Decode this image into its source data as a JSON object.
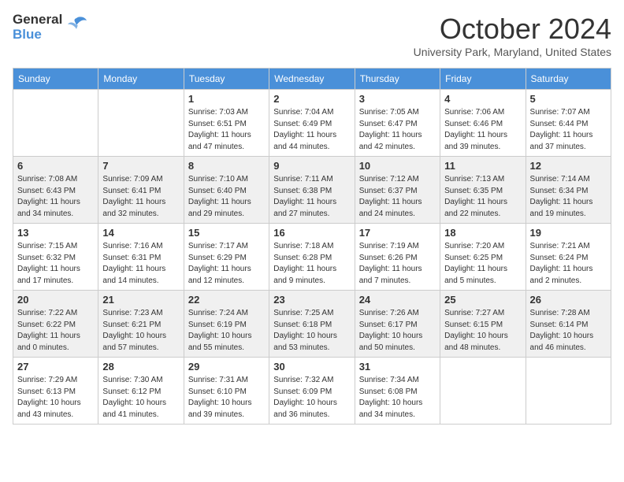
{
  "header": {
    "logo_general": "General",
    "logo_blue": "Blue",
    "month_title": "October 2024",
    "subtitle": "University Park, Maryland, United States"
  },
  "days_of_week": [
    "Sunday",
    "Monday",
    "Tuesday",
    "Wednesday",
    "Thursday",
    "Friday",
    "Saturday"
  ],
  "weeks": [
    [
      {
        "day": "",
        "sunrise": "",
        "sunset": "",
        "daylight": ""
      },
      {
        "day": "",
        "sunrise": "",
        "sunset": "",
        "daylight": ""
      },
      {
        "day": "1",
        "sunrise": "Sunrise: 7:03 AM",
        "sunset": "Sunset: 6:51 PM",
        "daylight": "Daylight: 11 hours and 47 minutes."
      },
      {
        "day": "2",
        "sunrise": "Sunrise: 7:04 AM",
        "sunset": "Sunset: 6:49 PM",
        "daylight": "Daylight: 11 hours and 44 minutes."
      },
      {
        "day": "3",
        "sunrise": "Sunrise: 7:05 AM",
        "sunset": "Sunset: 6:47 PM",
        "daylight": "Daylight: 11 hours and 42 minutes."
      },
      {
        "day": "4",
        "sunrise": "Sunrise: 7:06 AM",
        "sunset": "Sunset: 6:46 PM",
        "daylight": "Daylight: 11 hours and 39 minutes."
      },
      {
        "day": "5",
        "sunrise": "Sunrise: 7:07 AM",
        "sunset": "Sunset: 6:44 PM",
        "daylight": "Daylight: 11 hours and 37 minutes."
      }
    ],
    [
      {
        "day": "6",
        "sunrise": "Sunrise: 7:08 AM",
        "sunset": "Sunset: 6:43 PM",
        "daylight": "Daylight: 11 hours and 34 minutes."
      },
      {
        "day": "7",
        "sunrise": "Sunrise: 7:09 AM",
        "sunset": "Sunset: 6:41 PM",
        "daylight": "Daylight: 11 hours and 32 minutes."
      },
      {
        "day": "8",
        "sunrise": "Sunrise: 7:10 AM",
        "sunset": "Sunset: 6:40 PM",
        "daylight": "Daylight: 11 hours and 29 minutes."
      },
      {
        "day": "9",
        "sunrise": "Sunrise: 7:11 AM",
        "sunset": "Sunset: 6:38 PM",
        "daylight": "Daylight: 11 hours and 27 minutes."
      },
      {
        "day": "10",
        "sunrise": "Sunrise: 7:12 AM",
        "sunset": "Sunset: 6:37 PM",
        "daylight": "Daylight: 11 hours and 24 minutes."
      },
      {
        "day": "11",
        "sunrise": "Sunrise: 7:13 AM",
        "sunset": "Sunset: 6:35 PM",
        "daylight": "Daylight: 11 hours and 22 minutes."
      },
      {
        "day": "12",
        "sunrise": "Sunrise: 7:14 AM",
        "sunset": "Sunset: 6:34 PM",
        "daylight": "Daylight: 11 hours and 19 minutes."
      }
    ],
    [
      {
        "day": "13",
        "sunrise": "Sunrise: 7:15 AM",
        "sunset": "Sunset: 6:32 PM",
        "daylight": "Daylight: 11 hours and 17 minutes."
      },
      {
        "day": "14",
        "sunrise": "Sunrise: 7:16 AM",
        "sunset": "Sunset: 6:31 PM",
        "daylight": "Daylight: 11 hours and 14 minutes."
      },
      {
        "day": "15",
        "sunrise": "Sunrise: 7:17 AM",
        "sunset": "Sunset: 6:29 PM",
        "daylight": "Daylight: 11 hours and 12 minutes."
      },
      {
        "day": "16",
        "sunrise": "Sunrise: 7:18 AM",
        "sunset": "Sunset: 6:28 PM",
        "daylight": "Daylight: 11 hours and 9 minutes."
      },
      {
        "day": "17",
        "sunrise": "Sunrise: 7:19 AM",
        "sunset": "Sunset: 6:26 PM",
        "daylight": "Daylight: 11 hours and 7 minutes."
      },
      {
        "day": "18",
        "sunrise": "Sunrise: 7:20 AM",
        "sunset": "Sunset: 6:25 PM",
        "daylight": "Daylight: 11 hours and 5 minutes."
      },
      {
        "day": "19",
        "sunrise": "Sunrise: 7:21 AM",
        "sunset": "Sunset: 6:24 PM",
        "daylight": "Daylight: 11 hours and 2 minutes."
      }
    ],
    [
      {
        "day": "20",
        "sunrise": "Sunrise: 7:22 AM",
        "sunset": "Sunset: 6:22 PM",
        "daylight": "Daylight: 11 hours and 0 minutes."
      },
      {
        "day": "21",
        "sunrise": "Sunrise: 7:23 AM",
        "sunset": "Sunset: 6:21 PM",
        "daylight": "Daylight: 10 hours and 57 minutes."
      },
      {
        "day": "22",
        "sunrise": "Sunrise: 7:24 AM",
        "sunset": "Sunset: 6:19 PM",
        "daylight": "Daylight: 10 hours and 55 minutes."
      },
      {
        "day": "23",
        "sunrise": "Sunrise: 7:25 AM",
        "sunset": "Sunset: 6:18 PM",
        "daylight": "Daylight: 10 hours and 53 minutes."
      },
      {
        "day": "24",
        "sunrise": "Sunrise: 7:26 AM",
        "sunset": "Sunset: 6:17 PM",
        "daylight": "Daylight: 10 hours and 50 minutes."
      },
      {
        "day": "25",
        "sunrise": "Sunrise: 7:27 AM",
        "sunset": "Sunset: 6:15 PM",
        "daylight": "Daylight: 10 hours and 48 minutes."
      },
      {
        "day": "26",
        "sunrise": "Sunrise: 7:28 AM",
        "sunset": "Sunset: 6:14 PM",
        "daylight": "Daylight: 10 hours and 46 minutes."
      }
    ],
    [
      {
        "day": "27",
        "sunrise": "Sunrise: 7:29 AM",
        "sunset": "Sunset: 6:13 PM",
        "daylight": "Daylight: 10 hours and 43 minutes."
      },
      {
        "day": "28",
        "sunrise": "Sunrise: 7:30 AM",
        "sunset": "Sunset: 6:12 PM",
        "daylight": "Daylight: 10 hours and 41 minutes."
      },
      {
        "day": "29",
        "sunrise": "Sunrise: 7:31 AM",
        "sunset": "Sunset: 6:10 PM",
        "daylight": "Daylight: 10 hours and 39 minutes."
      },
      {
        "day": "30",
        "sunrise": "Sunrise: 7:32 AM",
        "sunset": "Sunset: 6:09 PM",
        "daylight": "Daylight: 10 hours and 36 minutes."
      },
      {
        "day": "31",
        "sunrise": "Sunrise: 7:34 AM",
        "sunset": "Sunset: 6:08 PM",
        "daylight": "Daylight: 10 hours and 34 minutes."
      },
      {
        "day": "",
        "sunrise": "",
        "sunset": "",
        "daylight": ""
      },
      {
        "day": "",
        "sunrise": "",
        "sunset": "",
        "daylight": ""
      }
    ]
  ]
}
